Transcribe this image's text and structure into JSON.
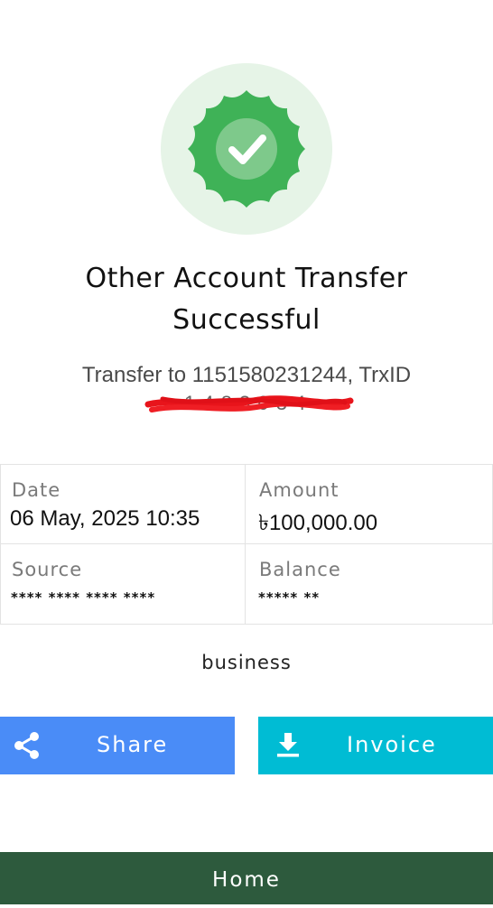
{
  "status": {
    "icon": "verified-badge-check-icon",
    "title_line1": "Other Account Transfer",
    "title_line2": "Successful",
    "subtitle": "Transfer to 1151580231244, TrxID",
    "colors": {
      "badge": "#3fb257",
      "badge_bg": "#e6f4e7"
    }
  },
  "details": {
    "date_label": "Date",
    "date_value": "06 May, 2025 10:35",
    "amount_label": "Amount",
    "amount_value": "৳100,000.00",
    "source_label": "Source",
    "source_value": "**** **** **** ****",
    "balance_label": "Balance",
    "balance_value": "***** **"
  },
  "note": "business",
  "actions": {
    "share_label": "Share",
    "share_icon": "share-icon",
    "invoice_label": "Invoice",
    "invoice_icon": "download-icon",
    "share_color": "#4a8cf7",
    "invoice_color": "#00bcd4"
  },
  "footer": {
    "home_label": "Home",
    "color": "#2d5a3d"
  }
}
